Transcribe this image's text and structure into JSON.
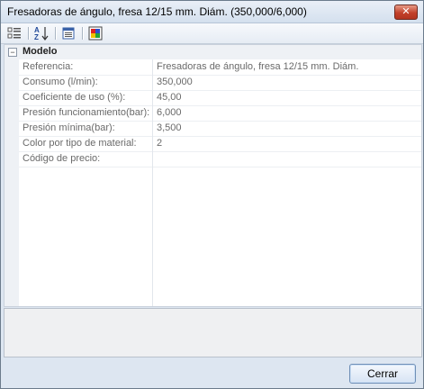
{
  "window": {
    "title": "Fresadoras de ángulo, fresa 12/15 mm. Diám. (350,000/6,000)",
    "close_glyph": "✕"
  },
  "toolbar": {
    "buttons": [
      {
        "icon": "categorized-view-icon"
      },
      {
        "icon": "alphabetical-sort-icon"
      },
      {
        "icon": "property-pages-icon"
      },
      {
        "icon": "color-palette-icon"
      }
    ]
  },
  "grid": {
    "category": {
      "label": "Modelo",
      "toggle_glyph": "−"
    },
    "properties": [
      {
        "name": "Referencia:",
        "value": "Fresadoras de ángulo, fresa 12/15 mm. Diám."
      },
      {
        "name": "Consumo (l/min):",
        "value": "350,000"
      },
      {
        "name": "Coeficiente de uso (%):",
        "value": "45,00"
      },
      {
        "name": "Presión funcionamiento(bar):",
        "value": "6,000"
      },
      {
        "name": "Presión mínima(bar):",
        "value": "3,500"
      },
      {
        "name": "Color por tipo de material:",
        "value": "2"
      },
      {
        "name": "Código de precio:",
        "value": ""
      }
    ]
  },
  "footer": {
    "close_label": "Cerrar"
  }
}
